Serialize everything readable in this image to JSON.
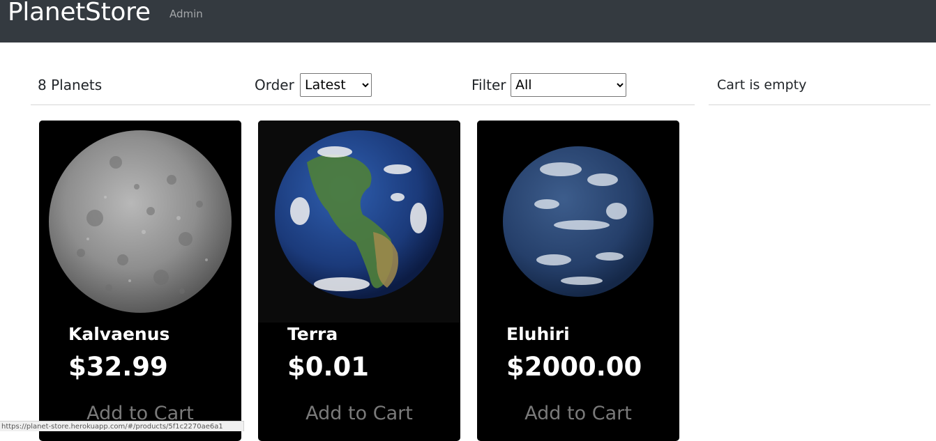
{
  "navbar": {
    "brand": "PlanetStore",
    "admin_link": "Admin"
  },
  "filter": {
    "count_text": "8 Planets",
    "order_label": "Order",
    "order_selected": "Latest",
    "filter_label": "Filter",
    "filter_selected": "All"
  },
  "cart": {
    "status": "Cart is empty"
  },
  "products": [
    {
      "name": "Kalvaenus",
      "price": "$32.99",
      "button": "Add to Cart",
      "image": "grey-cratered-planet"
    },
    {
      "name": "Terra",
      "price": "$0.01",
      "button": "Add to Cart",
      "image": "earth-americas"
    },
    {
      "name": "Eluhiri",
      "price": "$2000.00",
      "button": "Add to Cart",
      "image": "blue-cloudy-planet"
    }
  ],
  "status_bar": {
    "url": "https://planet-store.herokuapp.com/#/products/5f1c2270ae6a1"
  },
  "colors": {
    "navbar_bg": "#343a40",
    "card_bg": "#000000",
    "button_text": "#7a7a7a"
  }
}
